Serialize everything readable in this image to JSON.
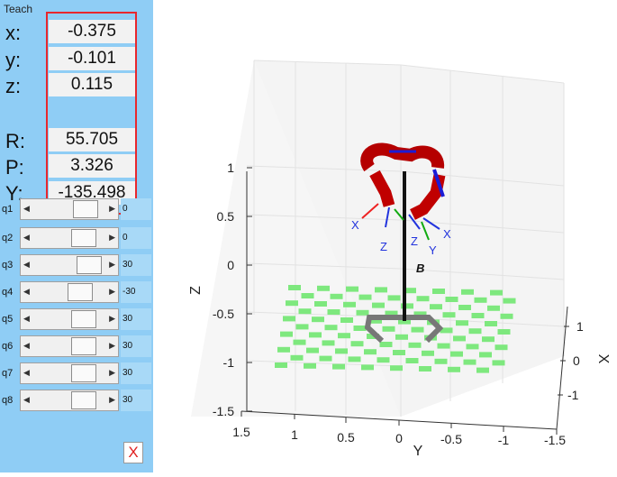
{
  "panel": {
    "title": "Teach"
  },
  "pose": [
    {
      "label": "x:",
      "value": "-0.375"
    },
    {
      "label": "y:",
      "value": "-0.101"
    },
    {
      "label": "z:",
      "value": "0.115"
    },
    {
      "label": "R:",
      "value": "55.705"
    },
    {
      "label": "P:",
      "value": "3.326"
    },
    {
      "label": "Y:",
      "value": "-135.498"
    }
  ],
  "highlight_color": "#e8272d",
  "joints": [
    {
      "label": "q1",
      "value": "0"
    },
    {
      "label": "q2",
      "value": "0"
    },
    {
      "label": "q3",
      "value": "30"
    },
    {
      "label": "q4",
      "value": "-30"
    },
    {
      "label": "q5",
      "value": "30"
    },
    {
      "label": "q6",
      "value": "30"
    },
    {
      "label": "q7",
      "value": "30"
    },
    {
      "label": "q8",
      "value": "30"
    }
  ],
  "close_button": {
    "label": "X"
  },
  "plot": {
    "z_axis_label": "Z",
    "y_axis_label": "Y",
    "x_axis_label": "X",
    "z_ticks": [
      "1",
      "0.5",
      "0",
      "-0.5",
      "-1",
      "-1.5"
    ],
    "y_ticks": [
      "1.5",
      "1",
      "0.5",
      "0",
      "-0.5",
      "-1",
      "-1.5"
    ],
    "x_ticks": [
      "1",
      "0",
      "-1"
    ],
    "base_label": "B",
    "frame_labels": [
      "X",
      "Z",
      "Z",
      "Y",
      "X"
    ]
  }
}
